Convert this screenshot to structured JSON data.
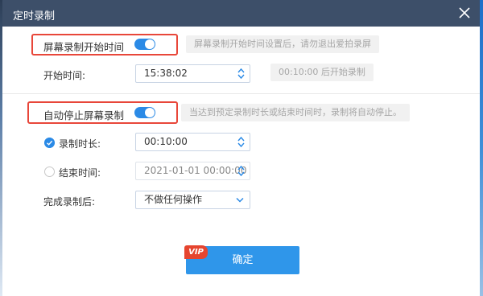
{
  "window": {
    "title": "定时录制"
  },
  "start_section": {
    "toggle_label": "屏幕录制开始时间",
    "toggle_on": true,
    "hint": "屏幕录制开始时间设置后，请勿退出爱拍录屏",
    "start_time_label": "开始时间:",
    "start_time_value": "15:38:02",
    "countdown_hint": "00:10:00 后开始录制"
  },
  "stop_section": {
    "toggle_label": "自动停止屏幕录制",
    "toggle_on": true,
    "hint": "当达到预定录制时长或结束时间时，录制将自动停止。",
    "duration_label": "录制时长:",
    "duration_value": "00:10:00",
    "duration_selected": true,
    "end_time_label": "结束时间:",
    "end_time_value": "2021-01-01 00:00:00",
    "end_time_selected": false,
    "after_label": "完成录制后:",
    "after_value": "不做任何操作"
  },
  "footer": {
    "vip_label": "VIP",
    "confirm_label": "确定"
  },
  "colors": {
    "accent": "#2b8ae6",
    "title_bar": "#3d4f69",
    "highlight": "#e8473a",
    "vip": "#e6452f"
  }
}
